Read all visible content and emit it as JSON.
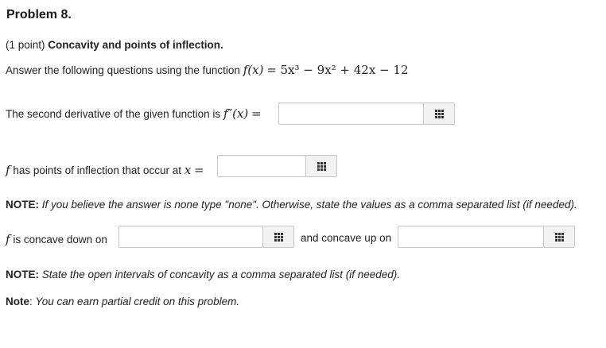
{
  "problem": {
    "title": "Problem 8.",
    "points": "(1 point)",
    "heading": "Concavity and points of inflection."
  },
  "intro": {
    "text": "Answer the following questions using the function",
    "function_lhs": "f(x)",
    "function_rhs": "= 5x³ − 9x² + 42x − 12"
  },
  "second_derivative": {
    "label": "The second derivative of the given function is",
    "math": "f″(x)",
    "eq": "=",
    "value": ""
  },
  "inflection": {
    "f": "f",
    "label": "has points of inflection that occur at",
    "x": "x",
    "eq": "=",
    "value": ""
  },
  "note1": {
    "bold": "NOTE:",
    "text": "If you believe the answer is none type \"none\". Otherwise, state the values as a comma separated list (if needed)."
  },
  "concavity": {
    "f": "f",
    "down_label": "is concave down on",
    "down_value": "",
    "up_label": "and concave up on",
    "up_value": ""
  },
  "note2": {
    "bold": "NOTE:",
    "text": "State the open intervals of concavity as a comma separated list (if needed)."
  },
  "note3": {
    "bold": "Note",
    "text": "You can earn partial credit on this problem."
  },
  "icons": {
    "tool_button": "equation-editor-grid-icon"
  }
}
